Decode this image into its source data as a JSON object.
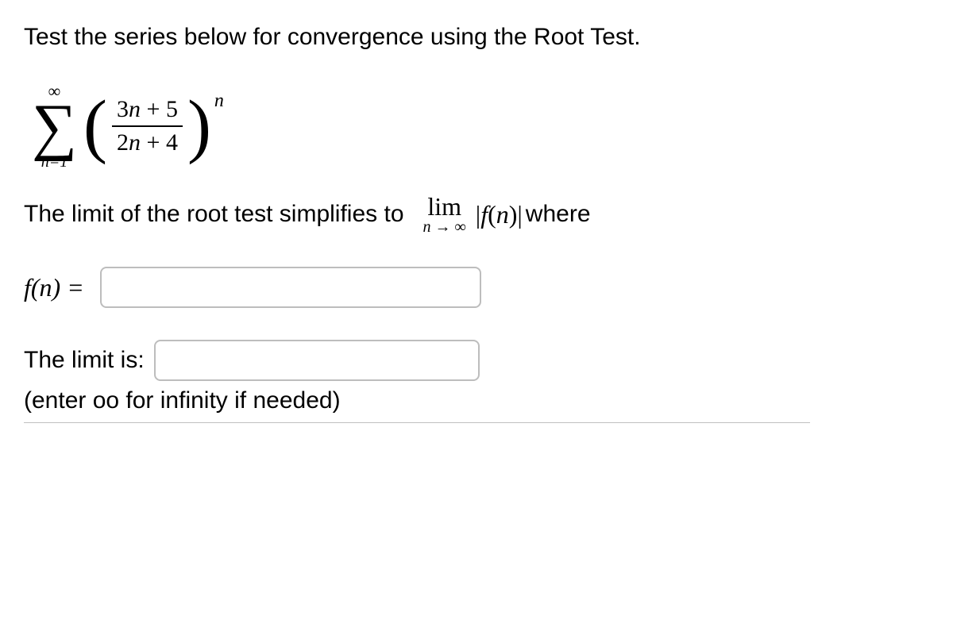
{
  "question": {
    "prompt": "Test the series below for convergence using the Root Test.",
    "series": {
      "sigma_top": "∞",
      "sigma_bottom_var": "n",
      "sigma_bottom_eq": "=",
      "sigma_bottom_val": "1",
      "numerator_a": "3",
      "numerator_var": "n",
      "numerator_plus": " + ",
      "numerator_b": "5",
      "denominator_a": "2",
      "denominator_var": "n",
      "denominator_plus": " + ",
      "denominator_b": "4",
      "exponent": "n"
    },
    "limit_text_before": "The limit of the root test simplifies to",
    "lim_label": "lim",
    "lim_sub_var": "n",
    "lim_sub_arrow": " → ",
    "lim_sub_inf": "∞",
    "abs_open": "|",
    "fn_f": "f",
    "fn_paren_open": "(",
    "fn_var": "n",
    "fn_paren_close": ")",
    "abs_close": "|",
    "limit_text_after": " where",
    "fn_label_f": "f",
    "fn_label_open": "(",
    "fn_label_var": "n",
    "fn_label_close": ")",
    "fn_label_eq": " =",
    "limit_is_label": "The limit is:",
    "hint": "(enter oo for infinity if needed)",
    "inputs": {
      "fn_value": "",
      "limit_value": ""
    }
  }
}
